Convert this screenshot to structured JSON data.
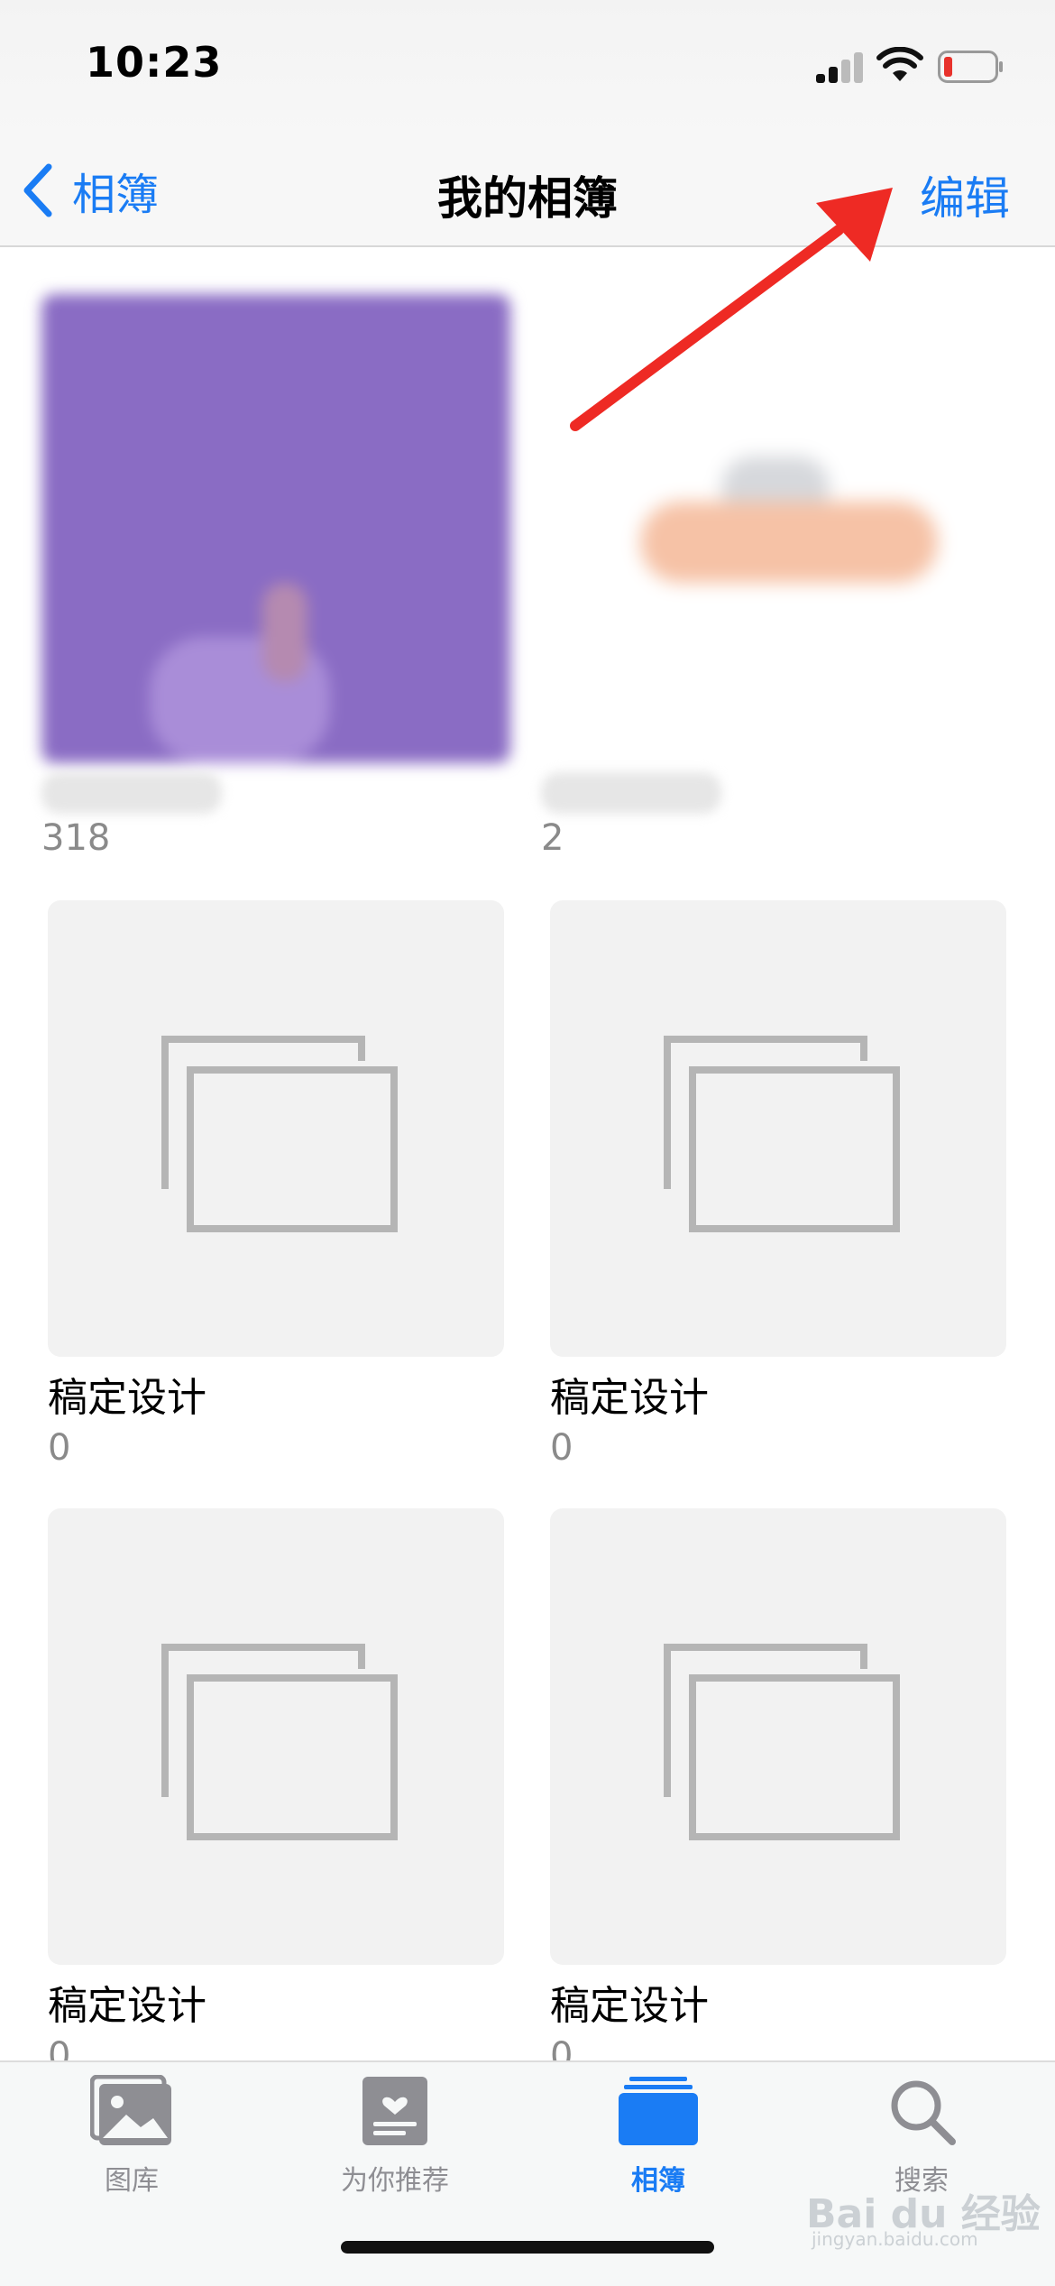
{
  "status_bar": {
    "time": "10:23"
  },
  "nav": {
    "back_label": "相簿",
    "title": "我的相簿",
    "edit_label": "编辑"
  },
  "albums": [
    {
      "name": "",
      "count": "318"
    },
    {
      "name": "",
      "count": "2"
    },
    {
      "name": "稿定设计",
      "count": "0"
    },
    {
      "name": "稿定设计",
      "count": "0"
    },
    {
      "name": "稿定设计",
      "count": "0"
    },
    {
      "name": "稿定设计",
      "count": "0"
    }
  ],
  "tabs": [
    {
      "label": "图库",
      "icon": "photo-library-icon"
    },
    {
      "label": "为你推荐",
      "icon": "for-you-icon"
    },
    {
      "label": "相簿",
      "icon": "albums-icon",
      "active": true
    },
    {
      "label": "搜索",
      "icon": "search-icon"
    }
  ],
  "watermark": {
    "text": "Bai du 经验",
    "sub": "jingyan.baidu.com"
  },
  "colors": {
    "accent": "#1a7cf4",
    "annotation_arrow": "#ee2a24",
    "battery_low": "#e8322c"
  }
}
